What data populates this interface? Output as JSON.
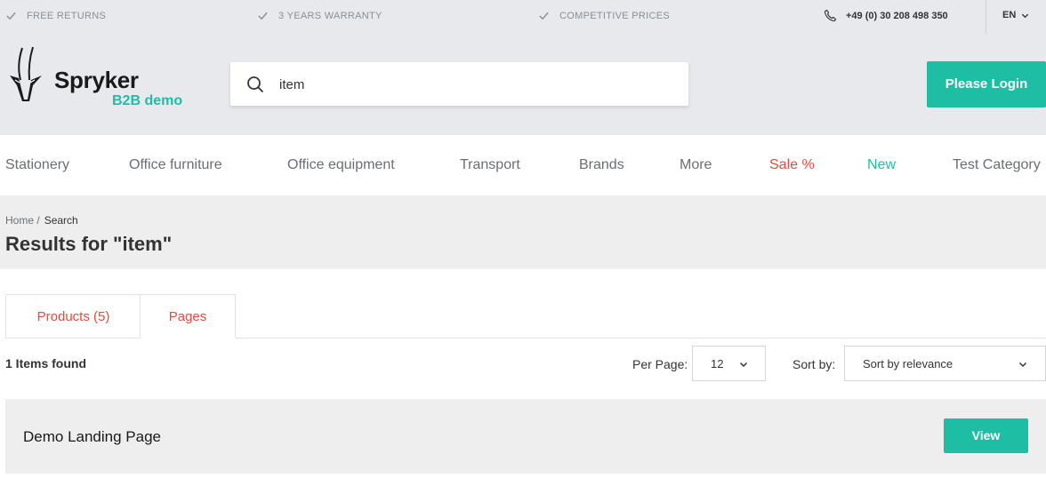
{
  "topbar": {
    "usps": [
      "FREE RETURNS",
      "3 YEARS WARRANTY",
      "COMPETITIVE PRICES"
    ],
    "phone": "+49 (0) 30 208 498 350",
    "language": "EN"
  },
  "header": {
    "logo_name": "Spryker",
    "logo_sub": "B2B demo",
    "search_value": "item",
    "login_label": "Please Login"
  },
  "nav": {
    "items": [
      "Stationery",
      "Office furniture",
      "Office equipment",
      "Transport",
      "Brands",
      "More",
      "Sale %",
      "New",
      "Test Category"
    ]
  },
  "breadcrumb": {
    "home": "Home /",
    "current": "Search"
  },
  "page_title": "Results for \"item\"",
  "tabs": [
    "Products (5)",
    "Pages"
  ],
  "results": {
    "found_text": "1 Items found",
    "per_page_label": "Per Page:",
    "per_page_value": "12",
    "sort_label": "Sort by:",
    "sort_value": "Sort by relevance"
  },
  "items": [
    {
      "title": "Demo Landing Page",
      "action": "View"
    }
  ],
  "colors": {
    "accent": "#1ebea5",
    "sale": "#e24d3a",
    "header_bg": "#e7e9ec"
  },
  "icons": [
    "check-icon",
    "phone-icon",
    "chevron-down-icon",
    "search-icon",
    "antelope-logo-icon"
  ]
}
